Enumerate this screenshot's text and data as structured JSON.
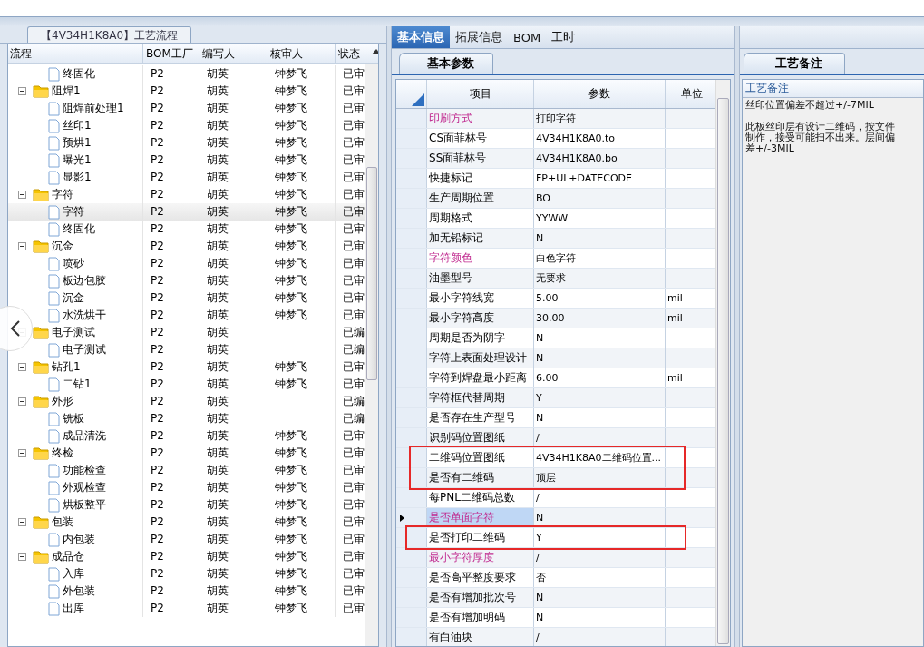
{
  "process_panel": {
    "title": "【4V34H1K8A0】工艺流程",
    "columns": [
      "流程",
      "BOM工厂",
      "编写人",
      "核审人",
      "状态"
    ],
    "rows": [
      {
        "kind": "file",
        "name": "终固化",
        "bom": "P2",
        "writer": "胡英",
        "reviewer": "钟梦飞",
        "status": "已审",
        "selected": false
      },
      {
        "kind": "folder",
        "name": "阻焊1",
        "bom": "P2",
        "writer": "胡英",
        "reviewer": "钟梦飞",
        "status": "已审",
        "selected": false,
        "expanded": true,
        "children": [
          {
            "kind": "file",
            "name": "阻焊前处理1",
            "bom": "P2",
            "writer": "胡英",
            "reviewer": "钟梦飞",
            "status": "已审",
            "selected": false
          },
          {
            "kind": "file",
            "name": "丝印1",
            "bom": "P2",
            "writer": "胡英",
            "reviewer": "钟梦飞",
            "status": "已审",
            "selected": false
          },
          {
            "kind": "file",
            "name": "预烘1",
            "bom": "P2",
            "writer": "胡英",
            "reviewer": "钟梦飞",
            "status": "已审",
            "selected": false
          },
          {
            "kind": "file",
            "name": "曝光1",
            "bom": "P2",
            "writer": "胡英",
            "reviewer": "钟梦飞",
            "status": "已审",
            "selected": false
          },
          {
            "kind": "file",
            "name": "显影1",
            "bom": "P2",
            "writer": "胡英",
            "reviewer": "钟梦飞",
            "status": "已审",
            "selected": false
          }
        ]
      },
      {
        "kind": "folder",
        "name": "字符",
        "bom": "P2",
        "writer": "胡英",
        "reviewer": "钟梦飞",
        "status": "已审",
        "selected": false,
        "expanded": true,
        "children": [
          {
            "kind": "file",
            "name": "字符",
            "bom": "P2",
            "writer": "胡英",
            "reviewer": "钟梦飞",
            "status": "已审",
            "selected": true
          },
          {
            "kind": "file",
            "name": "终固化",
            "bom": "P2",
            "writer": "胡英",
            "reviewer": "钟梦飞",
            "status": "已审",
            "selected": false
          }
        ]
      },
      {
        "kind": "folder",
        "name": "沉金",
        "bom": "P2",
        "writer": "胡英",
        "reviewer": "钟梦飞",
        "status": "已审",
        "selected": false,
        "expanded": true,
        "children": [
          {
            "kind": "file",
            "name": "喷砂",
            "bom": "P2",
            "writer": "胡英",
            "reviewer": "钟梦飞",
            "status": "已审",
            "selected": false
          },
          {
            "kind": "file",
            "name": "板边包胶",
            "bom": "P2",
            "writer": "胡英",
            "reviewer": "钟梦飞",
            "status": "已审",
            "selected": false
          },
          {
            "kind": "file",
            "name": "沉金",
            "bom": "P2",
            "writer": "胡英",
            "reviewer": "钟梦飞",
            "status": "已审",
            "selected": false
          },
          {
            "kind": "file",
            "name": "水洗烘干",
            "bom": "P2",
            "writer": "胡英",
            "reviewer": "钟梦飞",
            "status": "已审",
            "selected": false
          }
        ]
      },
      {
        "kind": "folder",
        "name": "电子测试",
        "bom": "P2",
        "writer": "胡英",
        "status": "已编",
        "selected": false,
        "expanded": true,
        "children": [
          {
            "kind": "file",
            "name": "电子测试",
            "bom": "P2",
            "writer": "胡英",
            "status": "已编",
            "selected": false
          }
        ]
      },
      {
        "kind": "folder",
        "name": "钻孔1",
        "bom": "P2",
        "writer": "胡英",
        "reviewer": "钟梦飞",
        "status": "已审",
        "selected": false,
        "expanded": true,
        "children": [
          {
            "kind": "file",
            "name": "二钻1",
            "bom": "P2",
            "writer": "胡英",
            "reviewer": "钟梦飞",
            "status": "已审",
            "selected": false
          }
        ]
      },
      {
        "kind": "folder",
        "name": "外形",
        "bom": "P2",
        "writer": "胡英",
        "status": "已编",
        "selected": false,
        "expanded": true,
        "children": [
          {
            "kind": "file",
            "name": "铣板",
            "bom": "P2",
            "writer": "胡英",
            "status": "已编",
            "selected": false
          },
          {
            "kind": "file",
            "name": "成品清洗",
            "bom": "P2",
            "writer": "胡英",
            "reviewer": "钟梦飞",
            "status": "已审",
            "selected": false
          }
        ]
      },
      {
        "kind": "folder",
        "name": "终检",
        "bom": "P2",
        "writer": "胡英",
        "reviewer": "钟梦飞",
        "status": "已审",
        "selected": false,
        "expanded": true,
        "children": [
          {
            "kind": "file",
            "name": "功能检查",
            "bom": "P2",
            "writer": "胡英",
            "reviewer": "钟梦飞",
            "status": "已审",
            "selected": false
          },
          {
            "kind": "file",
            "name": "外观检查",
            "bom": "P2",
            "writer": "胡英",
            "reviewer": "钟梦飞",
            "status": "已审",
            "selected": false
          },
          {
            "kind": "file",
            "name": "烘板整平",
            "bom": "P2",
            "writer": "胡英",
            "reviewer": "钟梦飞",
            "status": "已审",
            "selected": false
          }
        ]
      },
      {
        "kind": "folder",
        "name": "包装",
        "bom": "P2",
        "writer": "胡英",
        "reviewer": "钟梦飞",
        "status": "已审",
        "selected": false,
        "expanded": true,
        "children": [
          {
            "kind": "file",
            "name": "内包装",
            "bom": "P2",
            "writer": "胡英",
            "reviewer": "钟梦飞",
            "status": "已审",
            "selected": false
          }
        ]
      },
      {
        "kind": "folder",
        "name": "成品仓",
        "bom": "P2",
        "writer": "胡英",
        "reviewer": "钟梦飞",
        "status": "已审",
        "selected": false,
        "expanded": true,
        "children": [
          {
            "kind": "file",
            "name": "入库",
            "bom": "P2",
            "writer": "胡英",
            "reviewer": "钟梦飞",
            "status": "已审",
            "selected": false
          },
          {
            "kind": "file",
            "name": "外包装",
            "bom": "P2",
            "writer": "胡英",
            "reviewer": "钟梦飞",
            "status": "已审",
            "selected": false
          },
          {
            "kind": "file",
            "name": "出库",
            "bom": "P2",
            "writer": "胡英",
            "reviewer": "钟梦飞",
            "status": "已审",
            "selected": false
          }
        ]
      }
    ]
  },
  "detail_tabs": [
    {
      "label": "基本信息",
      "selected": true
    },
    {
      "label": "拓展信息",
      "selected": false
    },
    {
      "label": "BOM",
      "selected": false
    },
    {
      "label": "工时",
      "selected": false
    }
  ],
  "params_panel": {
    "tab": "基本参数",
    "columns": [
      "项目",
      "参数",
      "单位"
    ],
    "rows": [
      {
        "item": "印刷方式",
        "value": "打印字符",
        "required": true,
        "current": false,
        "marked": false
      },
      {
        "item": "CS面菲林号",
        "value": "4V34H1K8A0.to",
        "required": false,
        "current": false,
        "marked": false
      },
      {
        "item": "SS面菲林号",
        "value": "4V34H1K8A0.bo",
        "required": false,
        "current": false,
        "marked": false
      },
      {
        "item": "快捷标记",
        "value": "FP+UL+DATECODE",
        "required": false,
        "current": false,
        "marked": false
      },
      {
        "item": "生产周期位置",
        "value": "BO",
        "required": false,
        "current": false,
        "marked": false
      },
      {
        "item": "周期格式",
        "value": "YYWW",
        "required": false,
        "current": false,
        "marked": false
      },
      {
        "item": "加无铅标记",
        "value": "N",
        "required": false,
        "current": false,
        "marked": false
      },
      {
        "item": "字符颜色",
        "value": "白色字符",
        "required": true,
        "current": false,
        "marked": false
      },
      {
        "item": "油墨型号",
        "value": "无要求",
        "required": false,
        "current": false,
        "marked": false
      },
      {
        "item": "最小字符线宽",
        "value": "5.00",
        "unit": "mil",
        "required": false,
        "current": false,
        "marked": false
      },
      {
        "item": "最小字符高度",
        "value": "30.00",
        "unit": "mil",
        "required": false,
        "current": false,
        "marked": false
      },
      {
        "item": "周期是否为阴字",
        "value": "N",
        "required": false,
        "current": false,
        "marked": false
      },
      {
        "item": "字符上表面处理设计",
        "value": "N",
        "required": false,
        "current": false,
        "marked": false
      },
      {
        "item": "字符到焊盘最小距离",
        "value": "6.00",
        "unit": "mil",
        "required": false,
        "current": false,
        "marked": false
      },
      {
        "item": "字符框代替周期",
        "value": "Y",
        "required": false,
        "current": false,
        "marked": false
      },
      {
        "item": "是否存在生产型号",
        "value": "N",
        "required": false,
        "current": false,
        "marked": false
      },
      {
        "item": "识别码位置图纸",
        "value": "/",
        "required": false,
        "current": false,
        "marked": false
      },
      {
        "item": "二维码位置图纸",
        "value": "4V34H1K8A0二维码位置...",
        "required": false,
        "current": false,
        "marked": true
      },
      {
        "item": "是否有二维码",
        "value": "顶层",
        "required": false,
        "current": false,
        "marked": true
      },
      {
        "item": "每PNL二维码总数",
        "value": "/",
        "required": false,
        "current": false,
        "marked": false
      },
      {
        "item": "是否单面字符",
        "value": "N",
        "required": true,
        "current": true,
        "marked": false
      },
      {
        "item": "是否打印二维码",
        "value": "Y",
        "required": false,
        "current": false,
        "marked": true
      },
      {
        "item": "最小字符厚度",
        "value": "/",
        "required": true,
        "current": false,
        "marked": false
      },
      {
        "item": "是否高平整度要求",
        "value": "否",
        "required": false,
        "current": false,
        "marked": false
      },
      {
        "item": "是否有增加批次号",
        "value": "N",
        "required": false,
        "current": false,
        "marked": false
      },
      {
        "item": "是否有增加明码",
        "value": "N",
        "required": false,
        "current": false,
        "marked": false
      },
      {
        "item": "有白油块",
        "value": "/",
        "required": false,
        "current": false,
        "marked": false
      }
    ]
  },
  "remarks_panel": {
    "tab": "工艺备注",
    "column": "工艺备注",
    "text": "丝印位置偏差不超过+/-7MIL\n\n此板丝印层有设计二维码，按文件制作，接受可能扫不出来。层间偏差+/-3MIL"
  }
}
